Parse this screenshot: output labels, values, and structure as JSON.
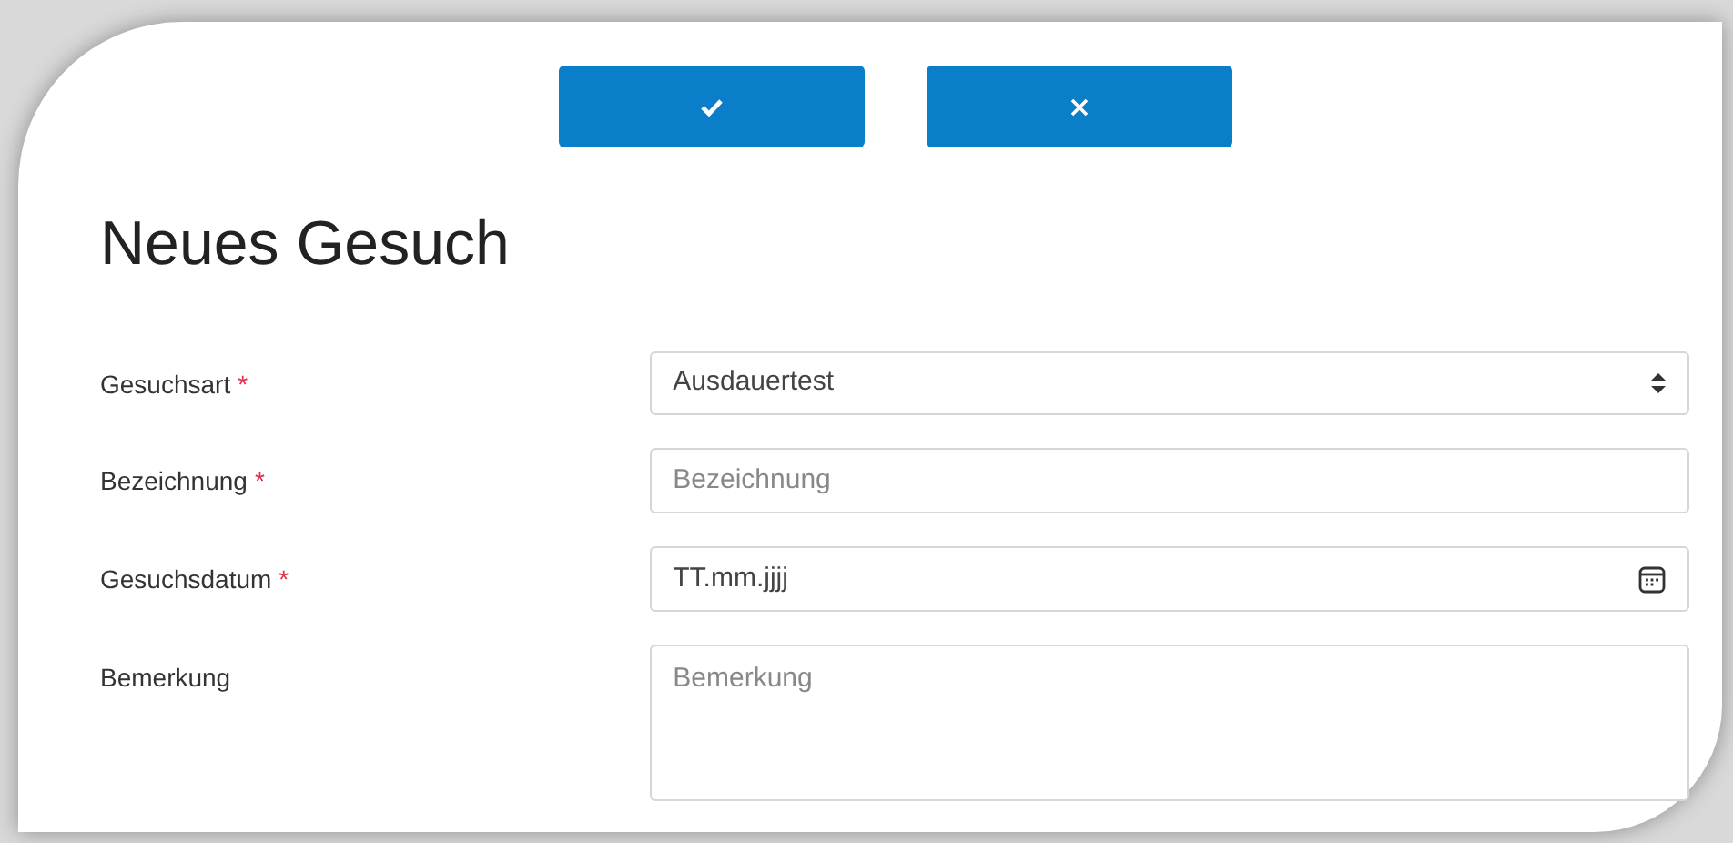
{
  "actions": [
    {
      "kind": "confirm"
    },
    {
      "kind": "cancel"
    }
  ],
  "title": "Neues Gesuch",
  "fields": [
    {
      "label": "Gesuchsart",
      "required": true,
      "kind": "select",
      "value": "Ausdauertest"
    },
    {
      "label": "Bezeichnung",
      "required": true,
      "kind": "text",
      "placeholder": "Bezeichnung"
    },
    {
      "label": "Gesuchsdatum",
      "required": true,
      "kind": "date",
      "placeholder": "TT.mm.jjjj"
    },
    {
      "label": "Bemerkung",
      "required": false,
      "kind": "textarea",
      "placeholder": "Bemerkung"
    }
  ],
  "required_mark": "*"
}
